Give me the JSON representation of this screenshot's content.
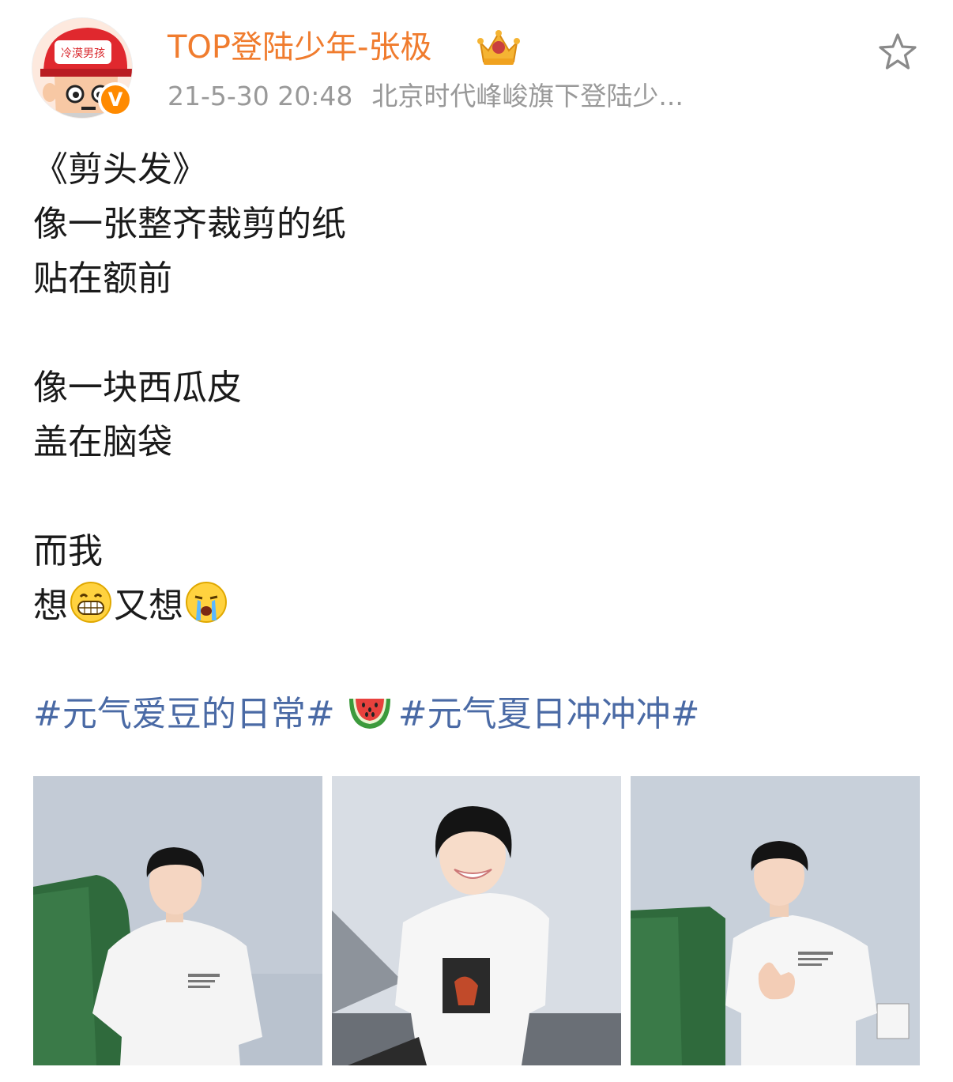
{
  "post": {
    "username": "TOP登陆少年-张极",
    "timestamp": "21-5-30 20:48",
    "source": "北京时代峰峻旗下登陆少...",
    "avatar_text": "冷漠男孩",
    "verified_mark": "V",
    "lines": {
      "title": "《剪头发》",
      "l1": "像一张整齐裁剪的纸",
      "l2": "贴在额前",
      "l3": "像一块西瓜皮",
      "l4": "盖在脑袋",
      "l5": "而我",
      "l6a": "想",
      "l6b": "又想"
    },
    "tags": {
      "tag1": "#元气爱豆的日常#",
      "tag2": "#元气夏日冲冲冲#"
    },
    "icons": {
      "favorite": "star-outline-icon",
      "crown": "crown-icon",
      "grin_emoji": "grinning-face-icon",
      "cry_emoji": "crying-face-icon",
      "melon_emoji": "watermelon-icon"
    }
  },
  "colors": {
    "username": "#f07c2e",
    "tag": "#4a6aa5",
    "meta": "#999999",
    "verified": "#ff8a00"
  }
}
